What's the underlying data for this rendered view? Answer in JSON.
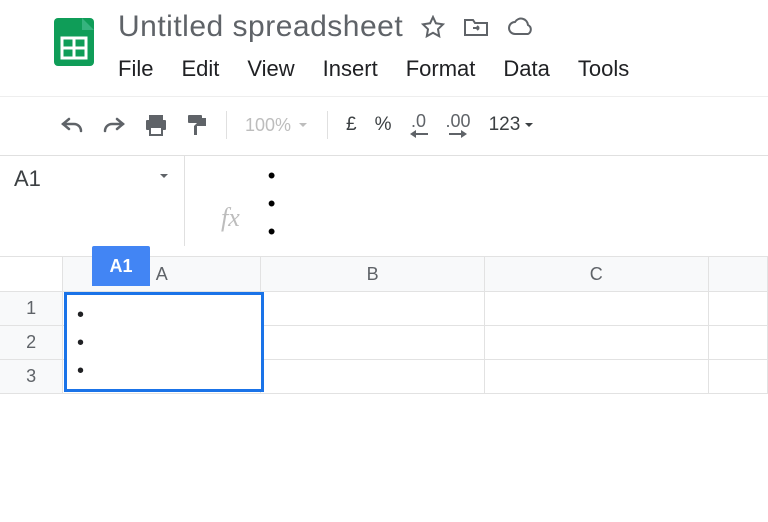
{
  "doc": {
    "title": "Untitled spreadsheet"
  },
  "menus": [
    "File",
    "Edit",
    "View",
    "Insert",
    "Format",
    "Data",
    "Tools"
  ],
  "toolbar": {
    "zoom": "100%",
    "currency": "£",
    "percent": "%",
    "dec_dec": ".0",
    "inc_dec": ".00",
    "more_fmt": "123"
  },
  "namebox": {
    "value": "A1"
  },
  "fx": {
    "label": "fx",
    "value": "•\n•\n•"
  },
  "grid": {
    "a1_tab": "A1",
    "cols": [
      "A",
      "B",
      "C"
    ],
    "rows": [
      "1",
      "2",
      "3"
    ],
    "active_cell_content": "•\n•\n•"
  }
}
